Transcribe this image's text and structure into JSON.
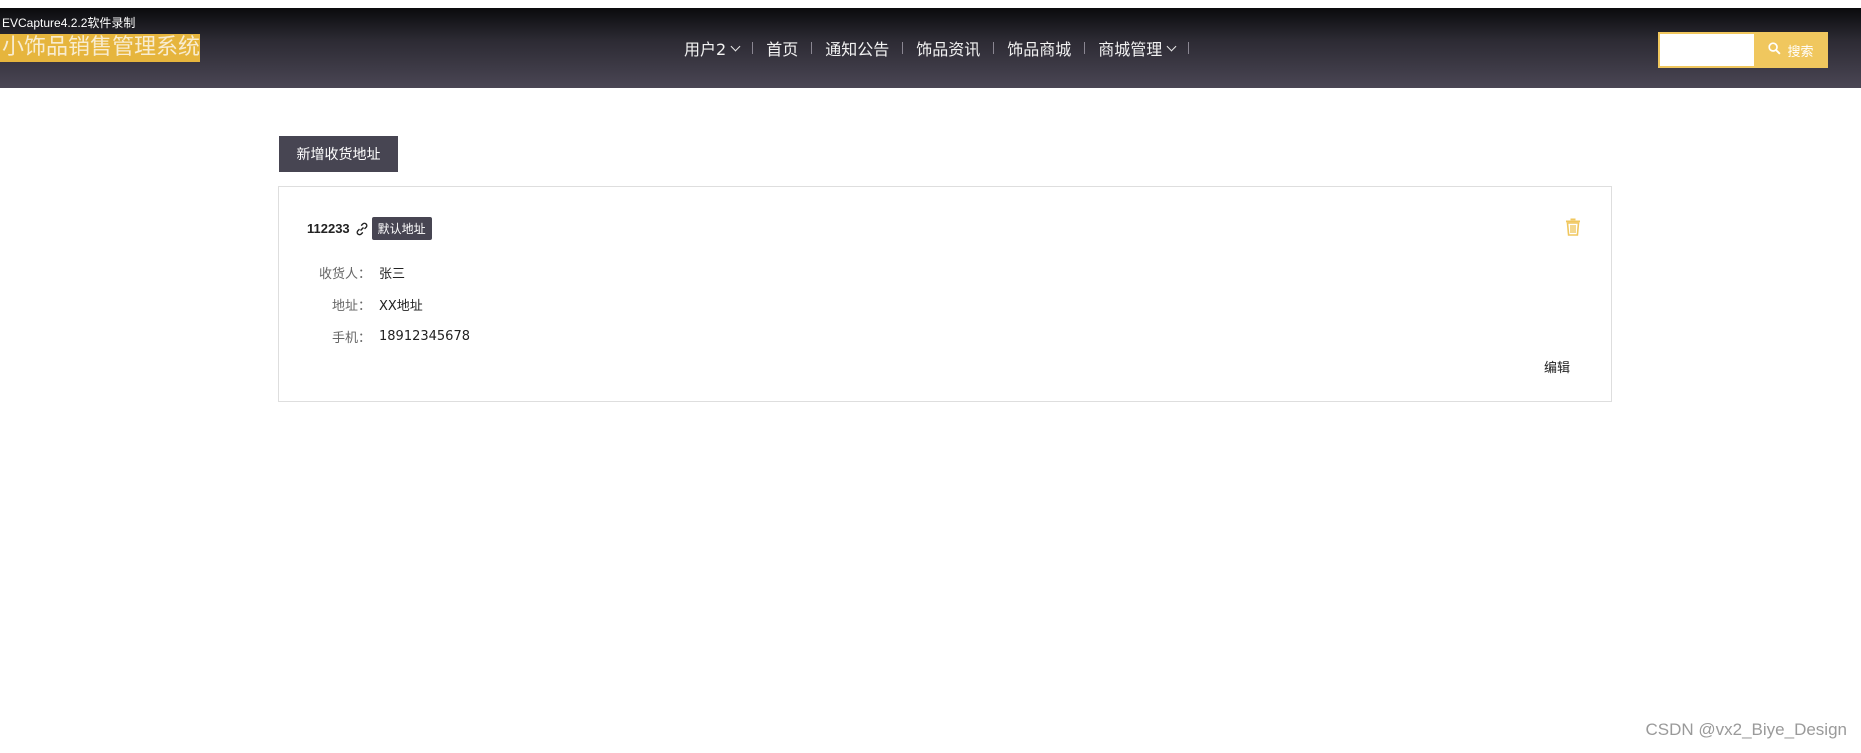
{
  "capture_tag": "EVCapture4.2.2软件录制",
  "header": {
    "brand": "小饰品销售管理系统",
    "nav": [
      {
        "label": "用户2",
        "dropdown": true
      },
      {
        "label": "首页",
        "dropdown": false
      },
      {
        "label": "通知公告",
        "dropdown": false
      },
      {
        "label": "饰品资讯",
        "dropdown": false
      },
      {
        "label": "饰品商城",
        "dropdown": false
      },
      {
        "label": "商城管理",
        "dropdown": true
      }
    ],
    "search": {
      "placeholder": "",
      "button_label": "搜索"
    }
  },
  "main": {
    "add_button_label": "新增收货地址",
    "address_card": {
      "title": "112233",
      "badge": "默认地址",
      "fields": [
        {
          "label": "收货人：",
          "value": "张三"
        },
        {
          "label": "地址：",
          "value": "XX地址"
        },
        {
          "label": "手机：",
          "value": "18912345678"
        }
      ],
      "edit_label": "编辑"
    }
  },
  "watermark": "CSDN @vx2_Biye_Design",
  "colors": {
    "accent": "#f0c75e",
    "dark_button": "#474552",
    "nav_bg_top": "#0a0a0d",
    "nav_bg_bottom": "#4a4654"
  }
}
